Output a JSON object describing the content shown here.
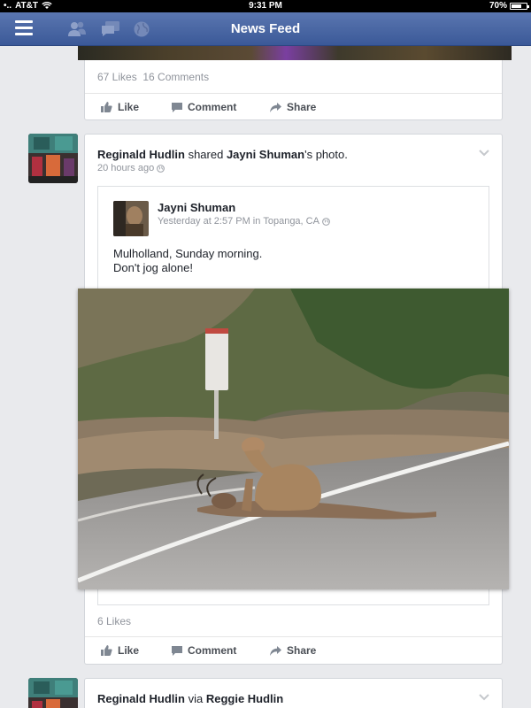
{
  "status_bar": {
    "carrier": "AT&T",
    "time": "9:31 PM",
    "battery": "70%",
    "battery_level": 0.7
  },
  "nav": {
    "title": "News Feed"
  },
  "post1": {
    "likes": "67 Likes",
    "comments": "16 Comments"
  },
  "actions": {
    "like": "Like",
    "comment": "Comment",
    "share": "Share"
  },
  "post2": {
    "author": "Reginald Hudlin",
    "verb": "shared",
    "owner": "Jayni Shuman",
    "owner_suffix": "'s photo.",
    "time": "20 hours ago",
    "shared": {
      "author": "Jayni Shuman",
      "time": "Yesterday at 2:57 PM",
      "in": "in",
      "place": "Topanga, CA",
      "line1": "Mulholland, Sunday morning.",
      "line2": "Don't jog alone!"
    },
    "likes": "6 Likes"
  },
  "post3": {
    "author": "Reginald Hudlin",
    "via": "via",
    "other": "Reggie Hudlin"
  },
  "colors": {
    "brand": "#3b5998",
    "text": "#1d2129",
    "meta": "#90949c"
  }
}
